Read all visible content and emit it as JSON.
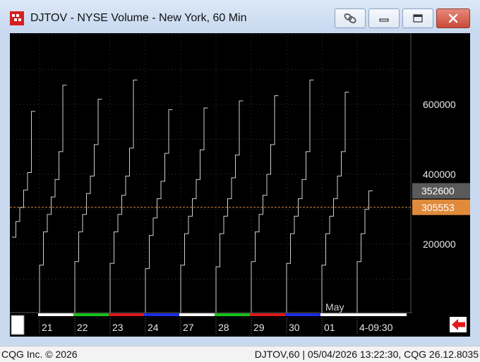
{
  "window": {
    "title": "DJTOV - NYSE Volume - New York, 60 Min"
  },
  "status_bar": {
    "left": "CQG Inc. © 2026",
    "right": "DJTOV,60 | 05/04/2026 13:22:30, CQG 26.12.8035"
  },
  "chart_data": {
    "type": "line",
    "title": "DJTOV - NYSE Volume - New York, 60 Min",
    "xlabel": "",
    "ylabel": "",
    "ylim": [
      0,
      900000
    ],
    "y_ticks": [
      {
        "value": 600000,
        "label": "600000"
      },
      {
        "value": 400000,
        "label": "400000"
      },
      {
        "value": 200000,
        "label": "200000"
      }
    ],
    "price_labels": [
      {
        "value": 352600,
        "label": "352600",
        "color": "#5a5a5a"
      },
      {
        "value": 305553,
        "label": "305553",
        "color": "#e08a3c"
      }
    ],
    "reference_line": {
      "value": 305553,
      "color": "#e08a3c"
    },
    "x_labels": [
      "21",
      "22",
      "23",
      "24",
      "27",
      "28",
      "29",
      "30",
      "01",
      "4-09:30"
    ],
    "month_label": "May",
    "session_colors": [
      "#ffffff",
      "#19c219",
      "#e01919",
      "#1a2ee6",
      "#ffffff",
      "#19c219",
      "#e01919",
      "#1a2ee6",
      "#ffffff"
    ],
    "grid": true,
    "series": [
      {
        "values": [
          220000,
          265000,
          305000,
          355000,
          405000,
          580000
        ]
      },
      {
        "values": [
          140000,
          235000,
          285000,
          335000,
          385000,
          465000,
          655000
        ]
      },
      {
        "values": [
          150000,
          235000,
          285000,
          345000,
          395000,
          485000,
          615000
        ]
      },
      {
        "values": [
          145000,
          235000,
          285000,
          340000,
          395000,
          475000,
          670000
        ]
      },
      {
        "values": [
          130000,
          225000,
          275000,
          330000,
          380000,
          460000,
          585000
        ]
      },
      {
        "values": [
          140000,
          230000,
          280000,
          330000,
          385000,
          470000,
          590000
        ]
      },
      {
        "values": [
          135000,
          230000,
          280000,
          330000,
          390000,
          455000,
          610000
        ]
      },
      {
        "values": [
          150000,
          235000,
          285000,
          340000,
          400000,
          485000,
          625000
        ]
      },
      {
        "values": [
          145000,
          230000,
          280000,
          330000,
          385000,
          465000,
          670000
        ]
      },
      {
        "values": [
          140000,
          230000,
          280000,
          330000,
          395000,
          465000,
          635000
        ]
      },
      {
        "values": [
          150000,
          230000,
          300000,
          352600
        ]
      }
    ]
  }
}
